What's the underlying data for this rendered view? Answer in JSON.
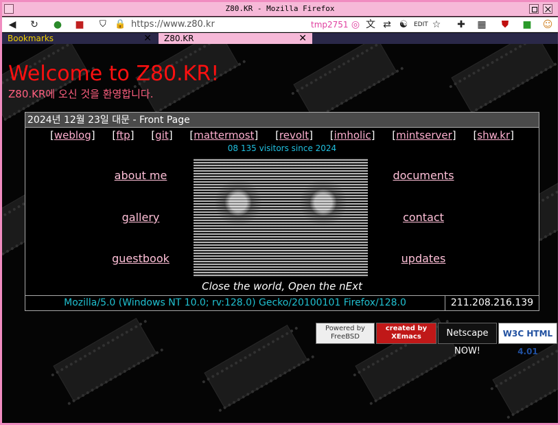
{
  "window": {
    "title": "Z80.KR - Mozilla Firefox"
  },
  "toolbar": {
    "url": "https://www.z80.kr",
    "profile_badge": "tmp2751",
    "icons": [
      "back-arrow-icon",
      "reload-icon",
      "extension-icon",
      "extension-icon",
      "shield-icon",
      "lock-icon",
      "translate-icon",
      "flag-icon",
      "edit-icon",
      "star-icon",
      "puzzle-icon",
      "grid-icon",
      "ublock-icon",
      "extension-icon",
      "avatar-icon"
    ]
  },
  "tabs": [
    {
      "label": "Bookmarks",
      "close": "✕"
    },
    {
      "label": "Z80.KR",
      "close": "✕"
    }
  ],
  "page": {
    "welcome": "Welcome to Z80.KR!",
    "subwelcome": "Z80.KR에 오신 것을 환영합니다.",
    "panel_title": "2024년 12월 23일 대문 - Front Page",
    "nav_links": [
      "weblog",
      "ftp",
      "git",
      "mattermost",
      "revolt",
      "imholic",
      "mintserver",
      "shw.kr"
    ],
    "visitors": "08 135 visitors since 2024",
    "left_links": [
      "about me",
      "gallery",
      "guestbook"
    ],
    "right_links": [
      "documents",
      "contact",
      "updates"
    ],
    "motto": "Close the world, Open the nExt",
    "user_agent": "Mozilla/5.0 (Windows NT 10.0; rv:128.0) Gecko/20100101 Firefox/128.0",
    "ip": "211.208.216.139",
    "badges": [
      "Powered by FreeBSD",
      "created by XEmacs",
      "Netscape NOW!",
      "W3C HTML 4.01"
    ]
  }
}
